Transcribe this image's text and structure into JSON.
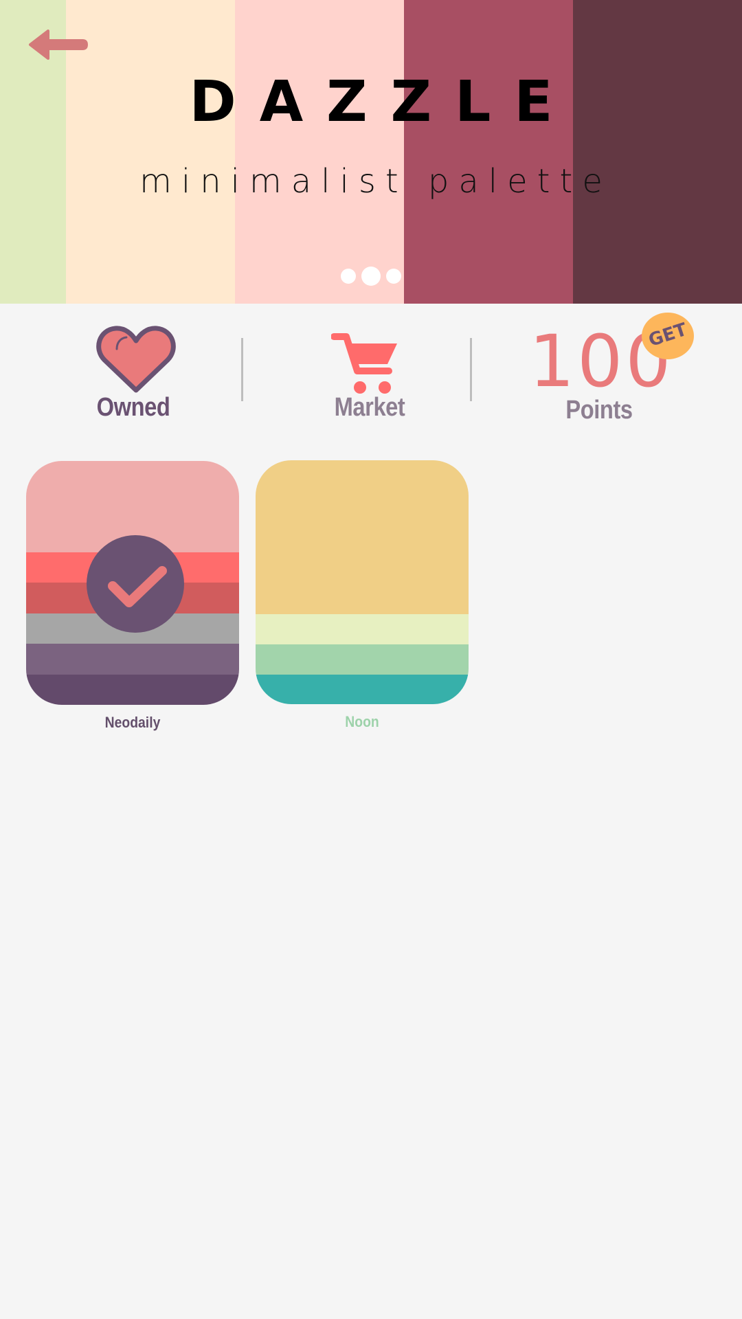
{
  "header": {
    "title": "DAZZLE",
    "subtitle": "minimalist palette",
    "back_icon": "back-arrow-icon",
    "stripe_colors": [
      "#e0ebbe",
      "#ffe9cf",
      "#ffd3cd",
      "#a84f63",
      "#633843"
    ],
    "dots_count": 3,
    "active_dot": 1
  },
  "nav": {
    "owned": {
      "label": "Owned",
      "icon": "heart-icon",
      "color": "#6a5272"
    },
    "market": {
      "label": "Market",
      "icon": "cart-icon",
      "color": "#8d7f91"
    },
    "points": {
      "value": "100",
      "label": "Points",
      "badge": "GET",
      "value_color": "#e97a7b",
      "badge_color": "#fdb65b"
    }
  },
  "palettes": [
    {
      "name": "Neodaily",
      "selected": true,
      "label_color": "#634f6b",
      "bands": [
        "#efadac",
        "#ff6c6c",
        "#d15c5d",
        "#a6a6a6",
        "#7b6380",
        "#634a6b"
      ]
    },
    {
      "name": "Noon",
      "selected": false,
      "label_color": "#9dd2aa",
      "bands": [
        "#f0cf86",
        "#e7f0c1",
        "#a2d4ab",
        "#37b0aa"
      ]
    }
  ],
  "colors": {
    "background": "#f5f5f5",
    "accent": "#e97a7b",
    "heart": "#e97a7b",
    "heart_outline": "#6a5272",
    "cart": "#ff6b6b",
    "check_circle": "#6a5272"
  }
}
